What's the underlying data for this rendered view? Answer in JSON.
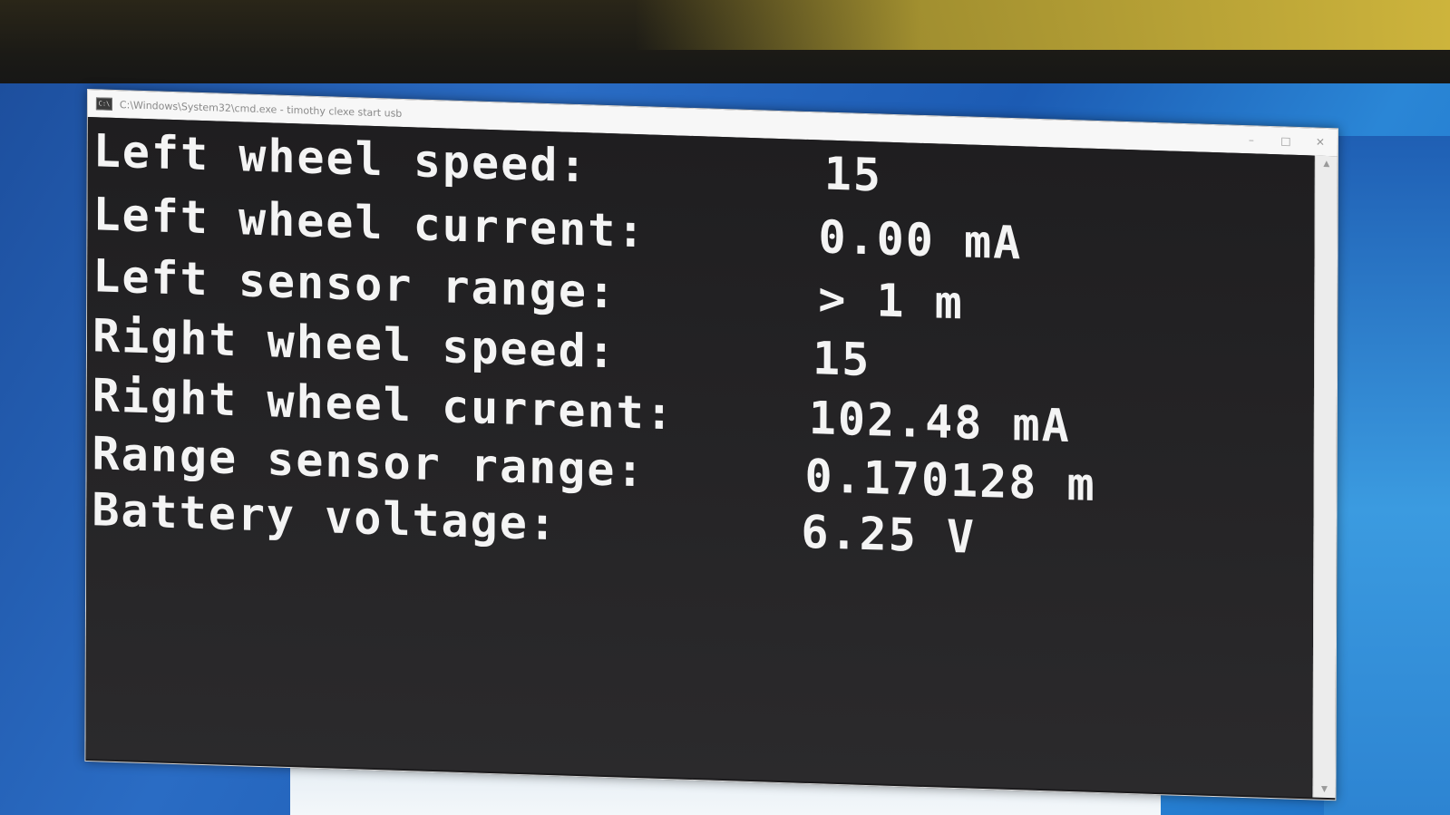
{
  "window": {
    "title": "C:\\Windows\\System32\\cmd.exe - timothy clexe start usb",
    "icon": "cmd-icon",
    "controls": {
      "minimize": "–",
      "maximize": "□",
      "close": "✕"
    }
  },
  "console": {
    "lines": [
      {
        "label": "Left wheel speed:",
        "value": "15"
      },
      {
        "label": "Left wheel current:",
        "value": "0.00 mA"
      },
      {
        "label": "Left sensor range:",
        "value": "> 1 m"
      },
      {
        "label": "Right wheel speed:",
        "value": "15"
      },
      {
        "label": "Right wheel current:",
        "value": "102.48 mA"
      },
      {
        "label": "Range sensor range:",
        "value": "0.170128 m"
      },
      {
        "label": "Battery voltage:",
        "value": "6.25 V"
      }
    ]
  },
  "colors": {
    "console_bg": "#1f1e20",
    "text": "#f4f4f4",
    "desktop": "#2a6cc4"
  }
}
